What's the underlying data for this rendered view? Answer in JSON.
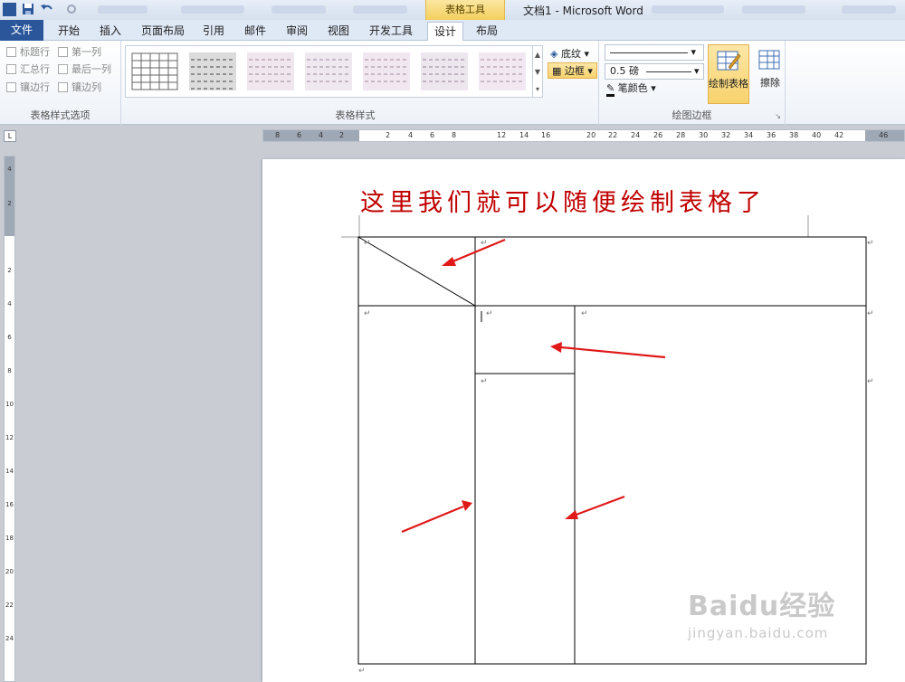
{
  "window": {
    "title": "文档1 - Microsoft Word",
    "context_header": "表格工具"
  },
  "tabs": [
    {
      "label": "文件"
    },
    {
      "label": "开始"
    },
    {
      "label": "插入"
    },
    {
      "label": "页面布局"
    },
    {
      "label": "引用"
    },
    {
      "label": "邮件"
    },
    {
      "label": "审阅"
    },
    {
      "label": "视图"
    },
    {
      "label": "开发工具"
    },
    {
      "label": "设计"
    },
    {
      "label": "布局"
    }
  ],
  "ribbon": {
    "style_options": {
      "group_label": "表格样式选项",
      "checkboxes": [
        "标题行",
        "第一列",
        "汇总行",
        "最后一列",
        "镶边行",
        "镶边列"
      ]
    },
    "table_styles": {
      "group_label": "表格样式",
      "shading_label": "底纹",
      "border_label": "边框"
    },
    "draw_borders": {
      "group_label": "绘图边框",
      "line_weight": "0.5 磅",
      "pen_color_label": "笔颜色",
      "draw_table_label": "绘制表格",
      "eraser_label": "擦除"
    }
  },
  "ruler": {
    "h_ticks": [
      "8",
      "6",
      "4",
      "2",
      "2",
      "4",
      "6",
      "8",
      "12",
      "14",
      "16",
      "20",
      "22",
      "24",
      "26",
      "28",
      "30",
      "32",
      "34",
      "36",
      "38",
      "40",
      "42",
      "46"
    ],
    "v_ticks": [
      "4",
      "2",
      "2",
      "4",
      "6",
      "8",
      "10",
      "12",
      "14",
      "16",
      "18",
      "20",
      "22",
      "24"
    ]
  },
  "document": {
    "hint": "这里我们就可以随便绘制表格了"
  },
  "watermark": {
    "brand": "Baidu经验",
    "url": "jingyan.baidu.com"
  },
  "colors": {
    "accent": "#2b579a",
    "highlight": "#f7d26d",
    "annotation": "#c00000",
    "arrow": "#e01919"
  },
  "icons": {
    "word": "word-logo-icon",
    "save": "save-icon",
    "undo": "undo-icon",
    "redo": "redo-icon",
    "shading": "paint-bucket-icon",
    "border": "border-icon",
    "pen": "pen-color-icon",
    "draw": "draw-table-icon",
    "erase": "eraser-icon"
  }
}
